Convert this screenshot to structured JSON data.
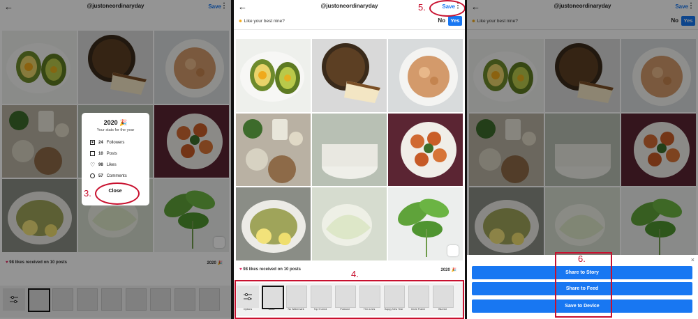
{
  "app": {
    "handle": "@justoneordinaryday",
    "save_label": "Save",
    "menu_icon": "kebab-icon",
    "back_icon": "back-arrow-icon"
  },
  "question": {
    "text": "Like your best nine?",
    "no_label": "No",
    "yes_label": "Yes",
    "emoji_icon": "smiley-icon"
  },
  "footer": {
    "likes_text": "98 likes received on 10 posts",
    "year_text": "2020"
  },
  "options_label": "Options",
  "templates": [
    "Basic",
    "No Watermark",
    "Top 9 Lined",
    "Polaroid",
    "Thin Lines",
    "Happy New Year",
    "Circle Frame",
    "Blurred"
  ],
  "modal": {
    "title": "2020",
    "subtitle": "Your stats for the year",
    "stats": [
      {
        "value": "24",
        "label": "Followers",
        "icon": "followers-icon"
      },
      {
        "value": "10",
        "label": "Posts",
        "icon": "posts-icon"
      },
      {
        "value": "98",
        "label": "Likes",
        "icon": "heart-icon"
      },
      {
        "value": "57",
        "label": "Comments",
        "icon": "comment-icon"
      }
    ],
    "close_label": "Close"
  },
  "share_sheet": {
    "buttons": [
      "Share to Story",
      "Share to Feed",
      "Save to Device"
    ],
    "close_icon": "close-icon"
  },
  "annotations": {
    "step3": "3.",
    "step4": "4.",
    "step5": "5.",
    "step6": "6."
  },
  "colors": {
    "accent": "#1877f2",
    "annotation": "#c8102e"
  }
}
